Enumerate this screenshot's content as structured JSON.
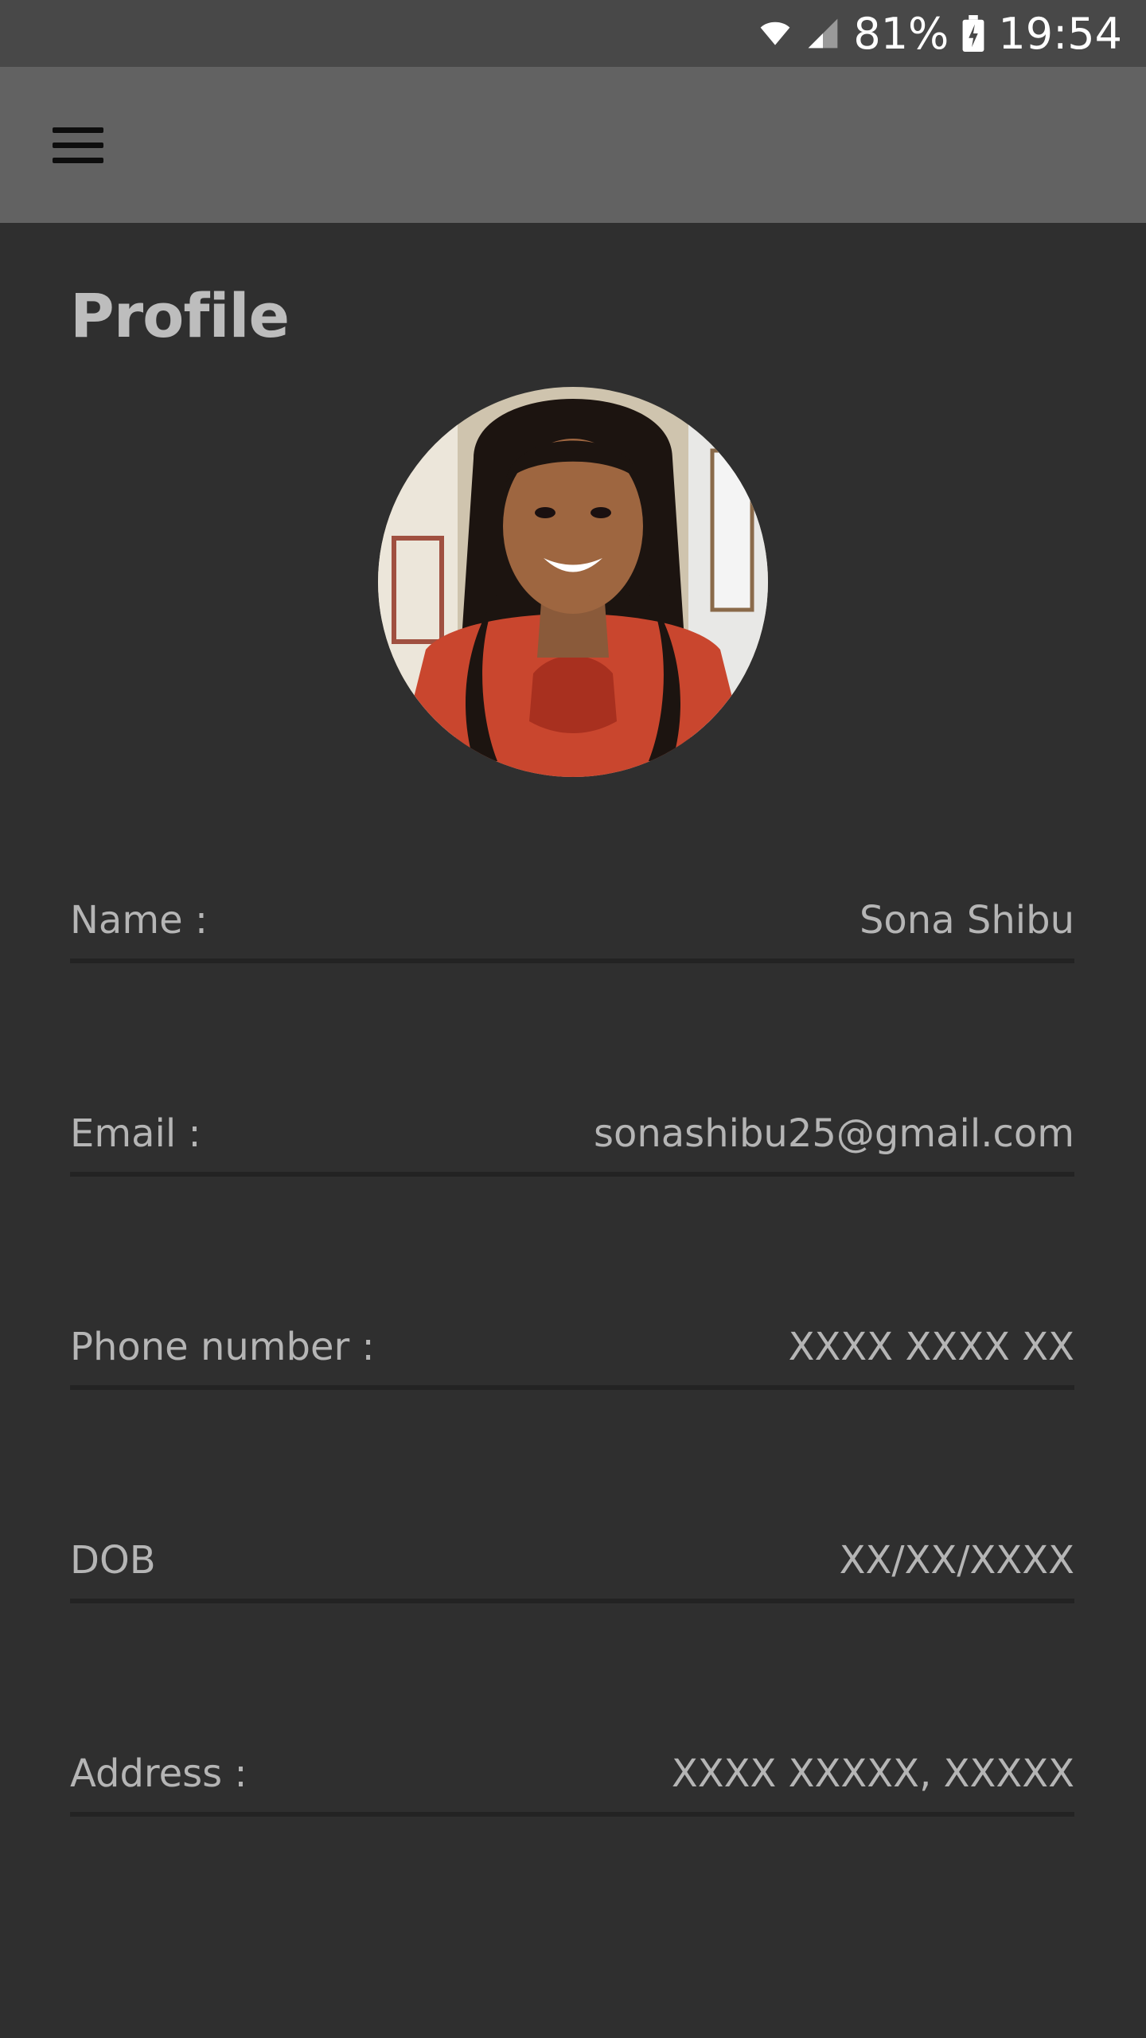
{
  "status_bar": {
    "battery": "81%",
    "time": "19:54"
  },
  "app_bar": {
    "menu_icon": "hamburger-menu-icon"
  },
  "page": {
    "title": "Profile"
  },
  "avatar": {
    "icon": "profile-photo"
  },
  "fields": [
    {
      "label": "Name :",
      "value": "Sona Shibu"
    },
    {
      "label": "Email :",
      "value": "sonashibu25@gmail.com"
    },
    {
      "label": "Phone number :",
      "value": "XXXX XXXX XX"
    },
    {
      "label": "DOB",
      "value": "XX/XX/XXXX"
    },
    {
      "label": "Address :",
      "value": "XXXX XXXXX, XXXXX"
    }
  ],
  "colors": {
    "background": "#2f2f2f",
    "status_bar": "#484848",
    "app_bar": "#626262",
    "text": "#b5b5b5"
  }
}
